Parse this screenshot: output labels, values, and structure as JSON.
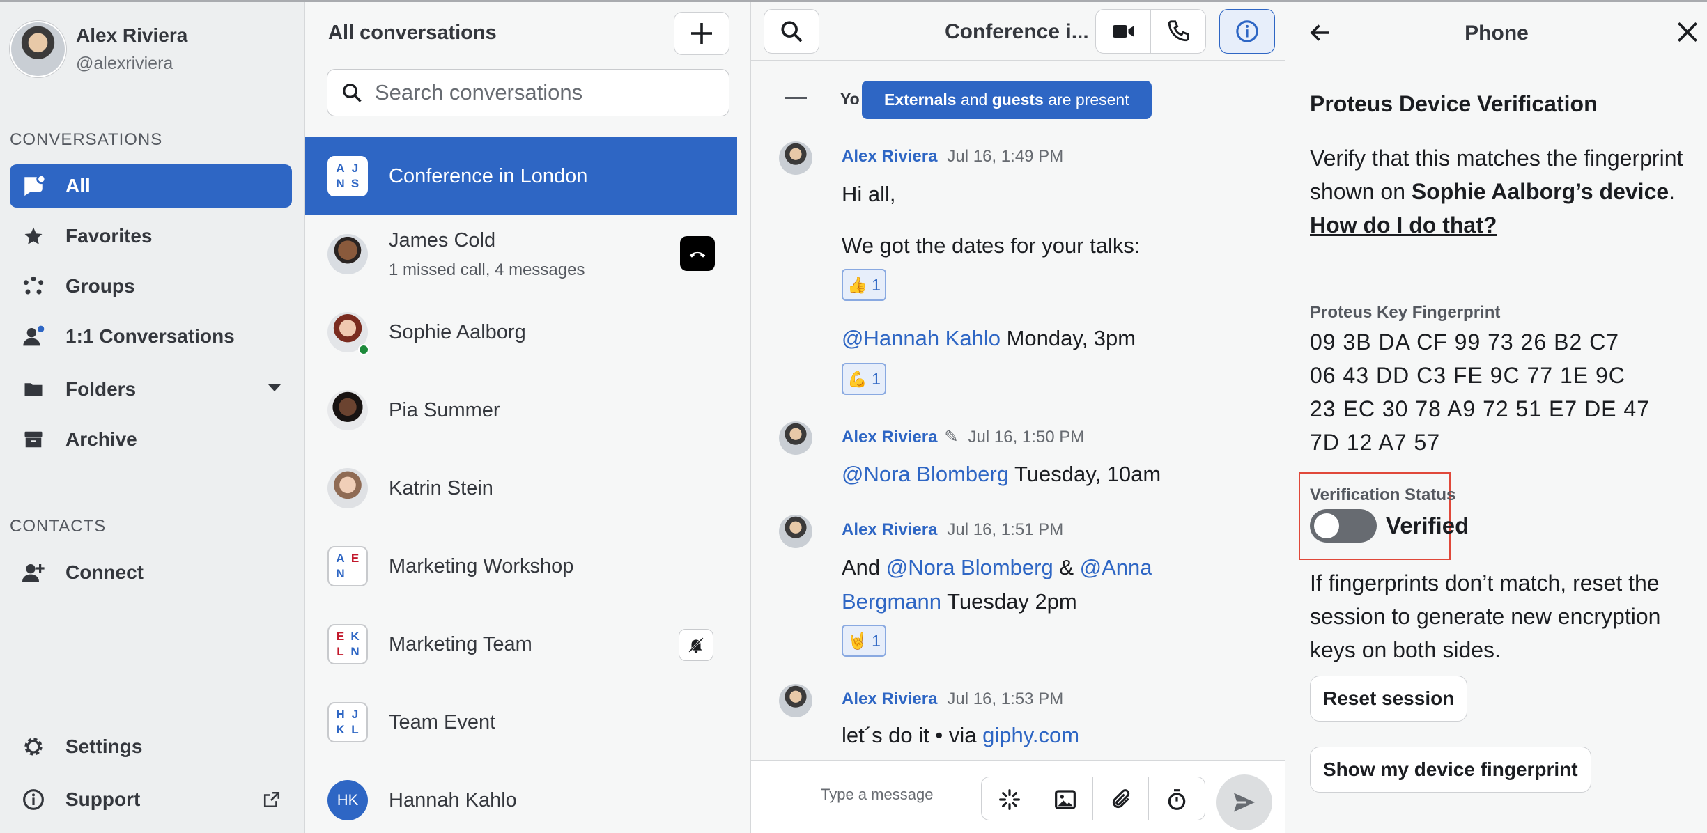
{
  "user": {
    "name": "Alex Riviera",
    "handle": "@alexriviera"
  },
  "sidebar": {
    "conversations_label": "CONVERSATIONS",
    "items": [
      {
        "label": "All",
        "icon": "chat-bubble-icon"
      },
      {
        "label": "Favorites",
        "icon": "star-icon"
      },
      {
        "label": "Groups",
        "icon": "groups-icon"
      },
      {
        "label": "1:1 Conversations",
        "icon": "person-icon"
      },
      {
        "label": "Folders",
        "icon": "folder-icon"
      },
      {
        "label": "Archive",
        "icon": "archive-icon"
      }
    ],
    "contacts_label": "CONTACTS",
    "connect_label": "Connect",
    "settings_label": "Settings",
    "support_label": "Support"
  },
  "conv_list": {
    "title": "All conversations",
    "search_placeholder": "Search conversations",
    "items": [
      {
        "name": "Conference in London",
        "initials": [
          "A",
          "J",
          "N",
          "S"
        ]
      },
      {
        "name": "James Cold",
        "sub": "1 missed call, 4 messages"
      },
      {
        "name": "Sophie Aalborg"
      },
      {
        "name": "Pia Summer"
      },
      {
        "name": "Katrin Stein"
      },
      {
        "name": "Marketing Workshop",
        "initials": [
          "A",
          "E",
          "N",
          ""
        ]
      },
      {
        "name": "Marketing Team",
        "initials": [
          "E",
          "K",
          "L",
          "N"
        ]
      },
      {
        "name": "Team Event",
        "initials": [
          "H",
          "J",
          "K",
          "L"
        ]
      },
      {
        "name": "Hannah Kahlo",
        "initials_text": "HK"
      }
    ]
  },
  "conversation": {
    "title": "Conference i...",
    "banner_prefix": "Yo",
    "banner": {
      "externals": "Externals",
      "and": "and",
      "guests": "guests",
      "suffix": "are present"
    },
    "messages": [
      {
        "author": "Alex Riviera",
        "time": "Jul 16, 1:49 PM",
        "greeting": "Hi all,",
        "line1": "We got the dates for your talks:",
        "reaction1": "👍 1",
        "mention1": "@Hannah Kahlo",
        "text1": " Monday, 3pm",
        "reaction2": "💪 1"
      },
      {
        "author": "Alex Riviera",
        "time": "Jul 16, 1:50 PM",
        "mention": "@Nora Blomberg",
        "text": " Tuesday, 10am"
      },
      {
        "author": "Alex Riviera",
        "time": "Jul 16, 1:51 PM",
        "pre": "And ",
        "mention1": "@Nora Blomberg",
        "mid": " & ",
        "mention2": "@Anna",
        "mention2b": "Bergmann",
        "text": " Tuesday 2pm",
        "reaction": "🤘 1"
      },
      {
        "author": "Alex Riviera",
        "time": "Jul 16, 1:53 PM",
        "text": "let´s do it • via ",
        "link": "giphy.com"
      }
    ],
    "composer_placeholder": "Type a message"
  },
  "panel": {
    "title": "Phone",
    "heading": "Proteus Device Verification",
    "verify_pre": "Verify that this matches the fingerprint shown on ",
    "verify_name": "Sophie Aalborg’s device",
    "verify_post": ".",
    "help_link": "How do I do that?",
    "fingerprint_label": "Proteus Key Fingerprint",
    "fingerprint_lines": [
      "09 3B DA CF 99 73 26 B2 C7",
      "06 43 DD C3 FE 9C 77 1E 9C",
      "23 EC 30 78 A9 72 51 E7 DE 47",
      "7D 12 A7 57"
    ],
    "status_label": "Verification Status",
    "toggle_label": "Verified",
    "reset_text": "If fingerprints don’t match, reset the session to generate new encryption keys on both sides.",
    "reset_button": "Reset session",
    "show_fp_button": "Show my device fingerprint"
  }
}
